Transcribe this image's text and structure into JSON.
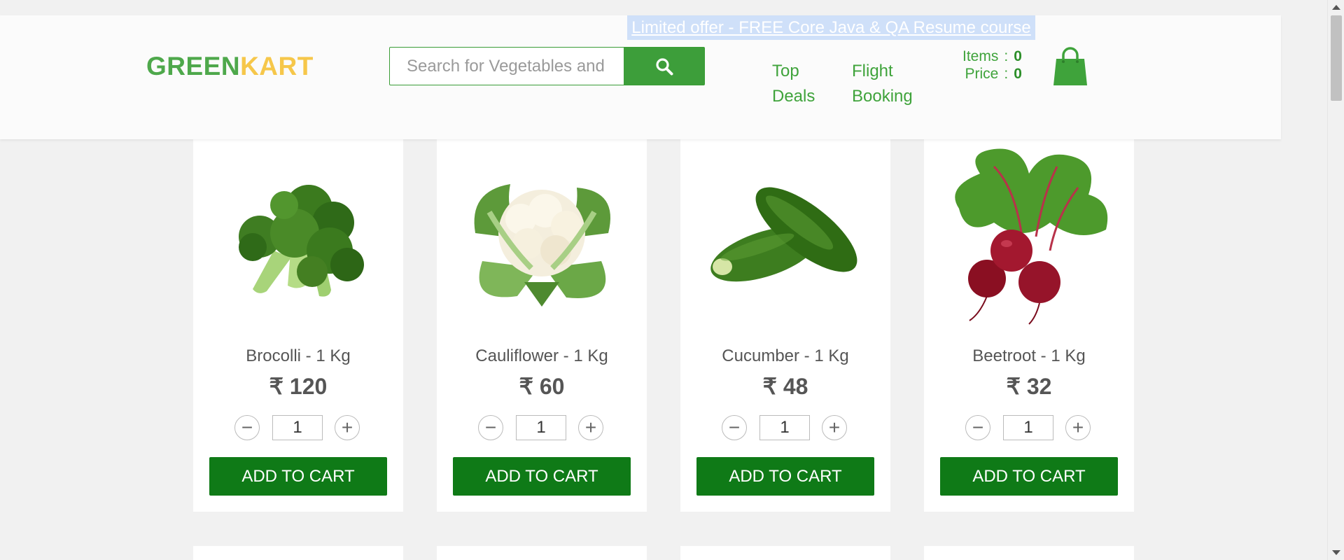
{
  "header": {
    "brand_first": "GREEN",
    "brand_second": "KART",
    "offer_text": "Limited offer - FREE Core Java & QA Resume course",
    "search": {
      "placeholder": "Search for Vegetables and Fruits",
      "icon": "search-icon"
    },
    "nav": [
      {
        "label_line1": "Top",
        "label_line2": "Deals"
      },
      {
        "label_line1": "Flight",
        "label_line2": "Booking"
      }
    ],
    "cart": {
      "items_label": "Items",
      "items_value": "0",
      "price_label": "Price",
      "price_value": "0",
      "separator": ":",
      "icon": "shopping-bag-icon"
    }
  },
  "products": [
    {
      "name": "Brocolli - 1 Kg",
      "price": "₹ 120",
      "qty": "1",
      "button": "ADD TO CART",
      "image": "broccoli"
    },
    {
      "name": "Cauliflower - 1 Kg",
      "price": "₹ 60",
      "qty": "1",
      "button": "ADD TO CART",
      "image": "cauliflower"
    },
    {
      "name": "Cucumber - 1 Kg",
      "price": "₹ 48",
      "qty": "1",
      "button": "ADD TO CART",
      "image": "cucumber"
    },
    {
      "name": "Beetroot - 1 Kg",
      "price": "₹ 32",
      "qty": "1",
      "button": "ADD TO CART",
      "image": "beetroot"
    }
  ],
  "colors": {
    "brand_green": "#4ea84b",
    "brand_yellow": "#f6c74a",
    "button_green": "#0f7a17",
    "search_green": "#3d9e3a"
  }
}
